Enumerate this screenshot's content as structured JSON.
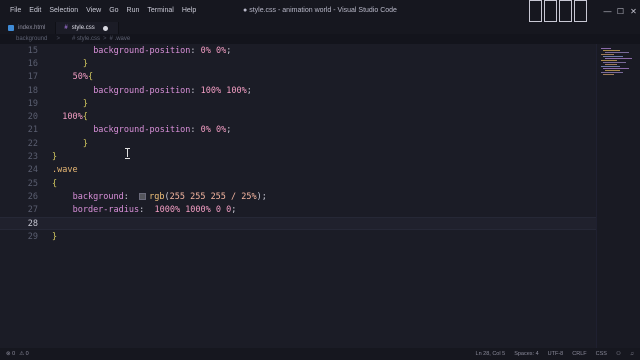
{
  "titlebar": {
    "menu": [
      "File",
      "Edit",
      "Selection",
      "View",
      "Go",
      "Run",
      "Terminal",
      "Help"
    ],
    "title": "● style.css - animation world - Visual Studio Code",
    "minimize": "—",
    "maximize": "☐",
    "close": "✕"
  },
  "tabs": [
    {
      "name": "index.html",
      "active": false
    },
    {
      "name": "style.css",
      "active": true
    }
  ],
  "breadcrumbs": {
    "left": [
      "background color",
      ">"
    ],
    "right": [
      "# style.css",
      ">",
      "# .wave"
    ]
  },
  "code": [
    {
      "n": "15",
      "indent": 4,
      "parts": [
        [
          "prop",
          "background-position"
        ],
        [
          "punct",
          ": "
        ],
        [
          "pct",
          "0% 0%"
        ],
        [
          "punct",
          ";"
        ]
      ]
    },
    {
      "n": "16",
      "indent": 3,
      "parts": [
        [
          "brace",
          "}"
        ]
      ]
    },
    {
      "n": "17",
      "indent": 2,
      "parts": [
        [
          "pct",
          "50%"
        ],
        [
          "brace",
          "{"
        ]
      ]
    },
    {
      "n": "18",
      "indent": 4,
      "parts": [
        [
          "prop",
          "background-position"
        ],
        [
          "punct",
          ": "
        ],
        [
          "pct",
          "100% 100%"
        ],
        [
          "punct",
          ";"
        ]
      ]
    },
    {
      "n": "19",
      "indent": 3,
      "parts": [
        [
          "brace",
          "}"
        ]
      ]
    },
    {
      "n": "20",
      "indent": 1,
      "parts": [
        [
          "pct",
          "100%"
        ],
        [
          "brace",
          "{"
        ]
      ]
    },
    {
      "n": "21",
      "indent": 4,
      "parts": [
        [
          "prop",
          "background-position"
        ],
        [
          "punct",
          ": "
        ],
        [
          "pct",
          "0% 0%"
        ],
        [
          "punct",
          ";"
        ]
      ]
    },
    {
      "n": "22",
      "indent": 3,
      "parts": [
        [
          "brace",
          "}"
        ]
      ]
    },
    {
      "n": "23",
      "indent": 0,
      "parts": [
        [
          "brace",
          "}"
        ]
      ]
    },
    {
      "n": "24",
      "indent": 0,
      "parts": [
        [
          "sel",
          ".wave"
        ]
      ]
    },
    {
      "n": "25",
      "indent": 0,
      "parts": [
        [
          "brace",
          "{"
        ]
      ]
    },
    {
      "n": "26",
      "indent": 2,
      "parts": [
        [
          "prop",
          "background"
        ],
        [
          "punct",
          ":  "
        ],
        [
          "swatch",
          ""
        ],
        [
          "func",
          "rgb"
        ],
        [
          "punct",
          "("
        ],
        [
          "val",
          "255 255 255 / 25%"
        ],
        [
          "punct",
          ");"
        ]
      ]
    },
    {
      "n": "27",
      "indent": 2,
      "parts": [
        [
          "prop",
          "border-radius"
        ],
        [
          "punct",
          ":  "
        ],
        [
          "pct",
          "1000% 1000% 0 0"
        ],
        [
          "punct",
          ";"
        ]
      ]
    },
    {
      "n": "28",
      "indent": 2,
      "parts": [],
      "current": true
    },
    {
      "n": "29",
      "indent": 0,
      "parts": [
        [
          "brace",
          "}"
        ]
      ]
    }
  ],
  "status": {
    "left": [
      "⊗ 0",
      "⚠ 0"
    ],
    "right": [
      "Ln 28, Col 5",
      "Spaces: 4",
      "UTF-8",
      "CRLF",
      "CSS",
      "⚇",
      "♫"
    ]
  },
  "colors": {
    "editor_bg": "#1b1c26",
    "property": "#d88fd8",
    "percent": "#f49ec4",
    "brace": "#d4ca60",
    "selector": "#e6b673"
  }
}
